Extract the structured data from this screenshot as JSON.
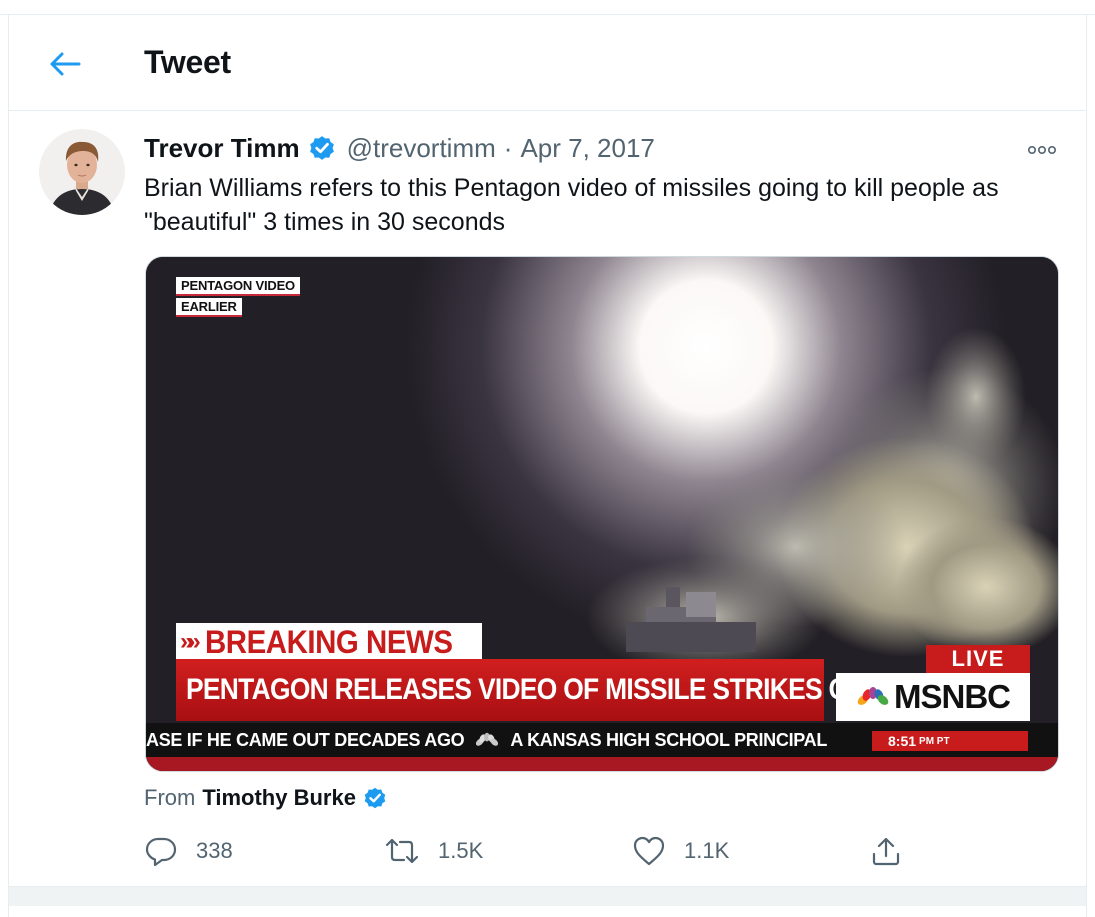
{
  "header": {
    "title": "Tweet",
    "back_icon": "arrow-left-icon"
  },
  "tweet": {
    "author_name": "Trevor Timm",
    "handle": "@trevortimm",
    "separator": "·",
    "date": "Apr 7, 2017",
    "text": "Brian Williams refers to this Pentagon video of missiles going to kill people as \"beautiful\" 3 times in 30 seconds",
    "verified_icon": "verified-badge-icon",
    "more_icon": "more-dots-icon"
  },
  "media": {
    "chip_line1": "PENTAGON VIDEO",
    "chip_line2": "EARLIER",
    "breaking_arrows": "»»",
    "breaking": "BREAKING NEWS",
    "headline": "PENTAGON RELEASES VIDEO OF MISSILE STRIKES ON SYRIA",
    "live": "LIVE",
    "network": "MSNBC",
    "ticker_left": "ASE IF HE CAME OUT DECADES AGO",
    "ticker_right": "A KANSAS HIGH SCHOOL PRINCIPAL",
    "clock_time": "8:51",
    "clock_suffix": "PM PT"
  },
  "attribution": {
    "prefix": "From",
    "name": "Timothy Burke"
  },
  "actions": {
    "replies": "338",
    "retweets": "1.5K",
    "likes": "1.1K"
  },
  "colors": {
    "accent": "#1d9bf0",
    "secondary_text": "#536471",
    "msnbc_red": "#c81b1b"
  }
}
